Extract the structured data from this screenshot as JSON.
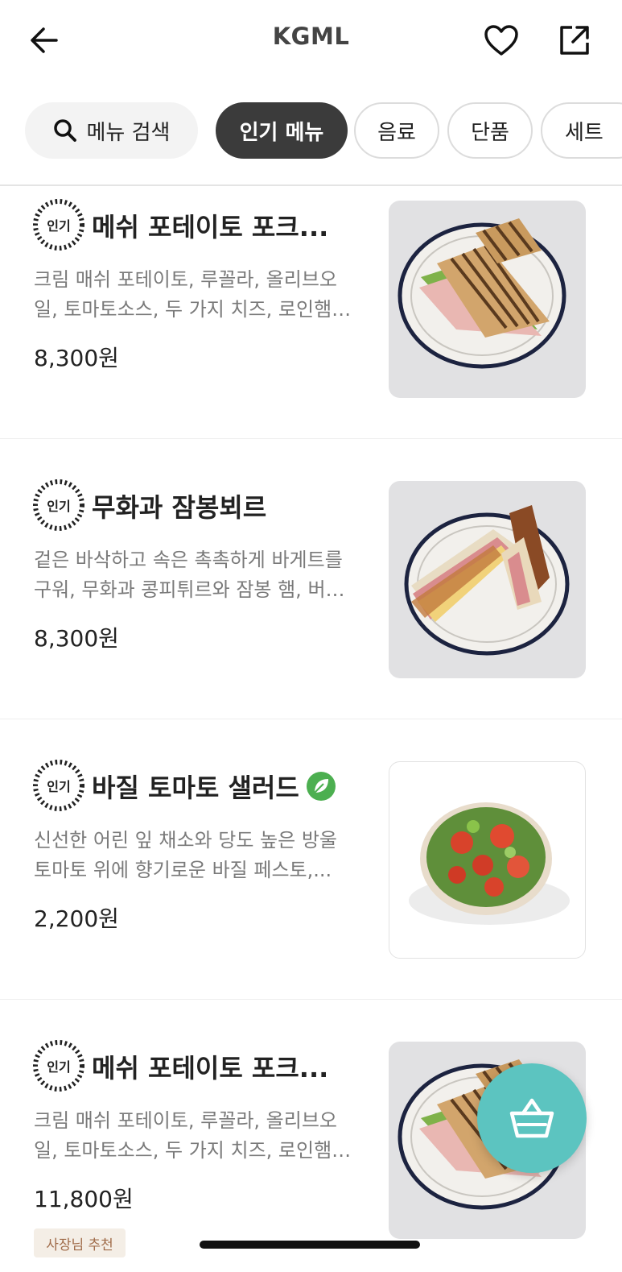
{
  "header": {
    "title": "KGML",
    "back_icon": "arrow-left-icon",
    "favorite_icon": "heart-icon",
    "share_icon": "share-icon"
  },
  "tabs": {
    "search_label": "메뉴 검색",
    "items": [
      {
        "label": "인기 메뉴",
        "active": true
      },
      {
        "label": "음료",
        "active": false
      },
      {
        "label": "단품",
        "active": false
      },
      {
        "label": "세트",
        "active": false
      }
    ]
  },
  "badge_label": "인기",
  "menu_items": [
    {
      "name": "메쉬 포테이토 포크...",
      "desc_line1": "크림 매쉬 포테이토, 루꼴라, 올리브오",
      "desc_line2": "일, 토마토소스, 두 가지 치즈, 로인햄…",
      "price": "8,300원",
      "image": "sandwich-photo"
    },
    {
      "name": "무화과 잠봉뵈르",
      "desc_line1": "겉은 바삭하고 속은 촉촉하게 바게트를",
      "desc_line2": "구워, 무화과 콩피튀르와 잠봉 햄, 버…",
      "price": "8,300원",
      "image": "baguette-sandwich-photo"
    },
    {
      "name": "바질 토마토 샐러드",
      "desc_line1": "신선한 어린 잎 채소와 당도 높은 방울",
      "desc_line2": "토마토 위에 향기로운 바질 페스토,...",
      "price": "2,200원",
      "image": "salad-photo",
      "vegan_icon": "leaf-icon"
    },
    {
      "name": "메쉬 포테이토 포크...",
      "desc_line1": "크림 매쉬 포테이토, 루꼴라, 올리브오",
      "desc_line2": "일, 토마토소스, 두 가지 치즈, 로인햄…",
      "price": "11,800원",
      "tag": "사장님 추천",
      "image": "sandwich-photo"
    }
  ],
  "cart": {
    "icon": "basket-icon"
  },
  "colors": {
    "accent": "#5cc4c0",
    "chip_active": "#3b3b3b",
    "leaf": "#4caf50",
    "tag_text": "#a06c4a"
  }
}
